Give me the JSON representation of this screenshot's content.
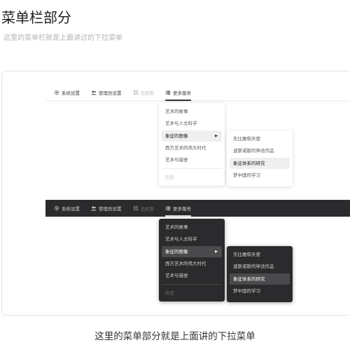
{
  "header": {
    "title": "菜单栏部分",
    "subtitle": "这里的菜单栏就是上面讲过的下拉菜单"
  },
  "menubar": {
    "items": [
      {
        "label": "系统设置",
        "icon": "gear-icon"
      },
      {
        "label": "管理员设置",
        "icon": "users-icon"
      },
      {
        "label": "无权限",
        "icon": "grid-icon"
      },
      {
        "label": "更多服务",
        "icon": "list-icon"
      }
    ]
  },
  "dropdown": {
    "items": [
      "艺术的故事",
      "艺术与人文科学",
      "象征的图像",
      "西方艺术的伟大时代",
      "艺术与错觉"
    ],
    "disabled_item": "历史",
    "submenu": [
      "东比雅和天使",
      "波斯诺斯的神话作品",
      "象征体系的研究",
      "梦中国的学习"
    ]
  },
  "caption": "这里的菜单部分就是上面讲的下拉菜单",
  "colors": {
    "dark_bg": "#2b2b2d",
    "light_bg": "#ffffff",
    "highlight_light": "#efefef",
    "highlight_dark": "#4a4a4d"
  }
}
